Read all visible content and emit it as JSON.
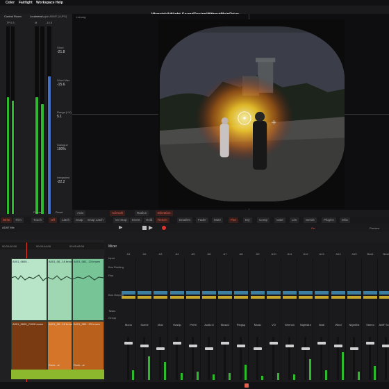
{
  "menubar": {
    "items": [
      "Color",
      "Fairlight",
      "Workspace",
      "Help"
    ],
    "project_title": "WarwickAtNight-SoundDesignWithoutMainDrive",
    "status": "Edited"
  },
  "loudness": {
    "title": "Control Room",
    "loudness_label": "Loudness",
    "mode": "Apple ASMT (LUFS)",
    "lo_long_label": "LoLong",
    "short_label": "Short",
    "short_value": "-21.8",
    "short_max_label": "Short Max",
    "short_max_value": "-15.6",
    "range_label": "Range (LU)",
    "range_value": "5.1",
    "dialogue_label": "Dialogue",
    "dialogue_value": "100%",
    "integrated_label": "Integrated",
    "integrated_value": "-22.2",
    "pause_label": "Pause",
    "reset_label": "Reset",
    "tp_label": "TP",
    "tp_value": "0.5",
    "m_label": "M",
    "m_value": "-14.5"
  },
  "viewer_tabs": [
    "Auto",
    "Azimuth",
    "Radius",
    "Elevation"
  ],
  "mode_row": [
    "Write",
    "Trim",
    "Touch",
    "Off",
    "Latch",
    "Snap",
    "Snap Latch",
    "On Stop",
    "Event",
    "Hold",
    "Return",
    "Enables",
    "Fader",
    "Mute",
    "Pan",
    "EQ",
    "Comp",
    "Gate",
    "Lim",
    "Sends",
    "Plugins",
    "Misc"
  ],
  "transport": {
    "track_select": "ADAT Mix",
    "on_label": "On",
    "preview": "Preview"
  },
  "timeline": {
    "timecodes": [
      "00:00:00:00",
      "00:00:04:00",
      "00:00:08:00"
    ],
    "clips_top": [
      "A001_0605...",
      "A001_08...16 brown",
      "A001_082...23 brown"
    ],
    "clips_bottom": [
      "A001_0605_C015 brown",
      "A001_08...16 brown",
      "A001_082...23 brown"
    ],
    "extra_bottom": [
      "Rock...al",
      "Rock...al"
    ]
  },
  "mixer": {
    "title": "Mixer",
    "row_labels": [
      "Input",
      "Bus Routing",
      "Pan",
      "Bus Outputs",
      "Tasks",
      "Group"
    ],
    "channels": [
      "A1",
      "A2",
      "A3",
      "A4",
      "A5",
      "A6",
      "A7",
      "A8",
      "A9",
      "A10",
      "A11",
      "A12",
      "A13",
      "A14",
      "A15",
      "Bus1",
      "Bus2"
    ],
    "channel_names": [
      "Mono",
      "Scene",
      "Mon",
      "Hashp",
      "Pertti",
      "Audio 6",
      "Music2",
      "Ringsp",
      "Music",
      "VO",
      "Wrench",
      "Nightsfur",
      "Stab",
      "Wind",
      "NightSfx",
      "Stereo",
      "AMF Scene"
    ],
    "accent_color": "#3c7fa2",
    "tag_color": "#c6a72c",
    "meter_color": "#2dbb2d"
  },
  "status": {
    "pages": [
      "Media",
      "Cut",
      "Edit",
      "Fusion",
      "Color",
      "Fairlight",
      "Deliver"
    ]
  }
}
